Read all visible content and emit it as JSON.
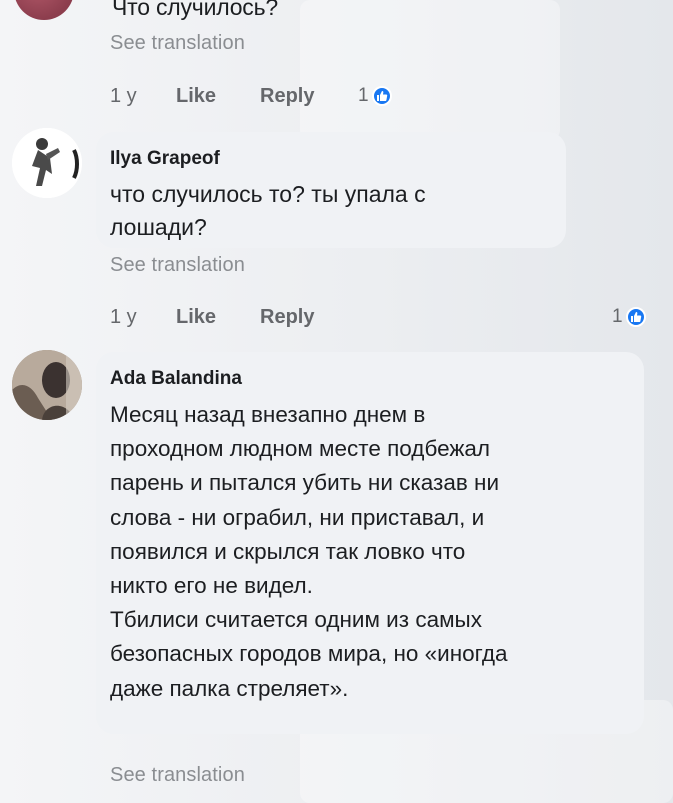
{
  "comments": [
    {
      "text": "Что случилось?",
      "see_translation": "See translation",
      "age": "1 y",
      "like": "Like",
      "reply": "Reply",
      "reaction_count": "1"
    },
    {
      "author": "Ilya Grapeof",
      "text": "что случилось то? ты упала с\nлошади?",
      "see_translation": "See translation",
      "age": "1 y",
      "like": "Like",
      "reply": "Reply",
      "reaction_count": "1"
    },
    {
      "author": "Ada Balandina",
      "text": " Месяц назад внезапно днем в\nпроходном людном месте подбежал\nпарень и пытался убить ни сказав ни\nслова - ни ограбил, ни приставал, и\nпоявился и скрылся так ловко что\nникто его не видел.\nТбилиси считается одним из самых\nбезопасных городов мира, но «иногда\nдаже палка стреляет».",
      "see_translation": "See translation"
    }
  ],
  "colors": {
    "like_blue": "#1877f2",
    "meta_gray": "#65676b",
    "translation_gray": "#8a8d91",
    "bubble_bg": "#f0f2f5"
  },
  "icons": {
    "reaction": "thumbs-up-icon"
  }
}
